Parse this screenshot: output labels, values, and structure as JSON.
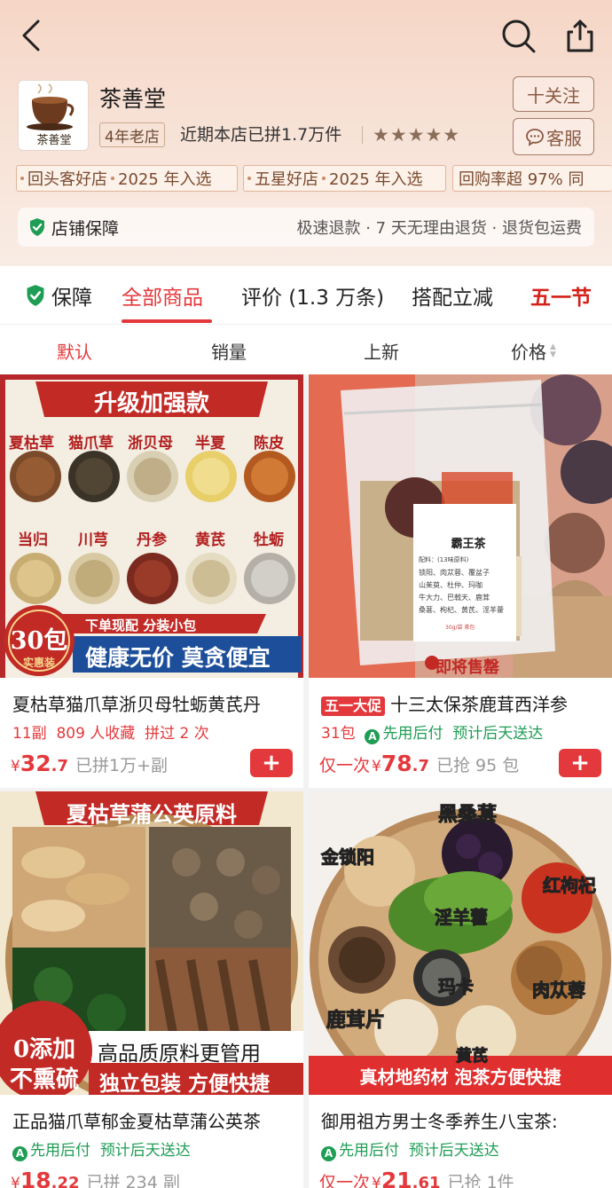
{
  "header": {
    "back_icon": "chevron-left-icon",
    "search_icon": "search-icon",
    "share_icon": "share-icon"
  },
  "store": {
    "name": "茶善堂",
    "logo_text": "茶善堂",
    "years_badge": "4年老店",
    "recent_sales": "近期本店已拼1.7万件",
    "rating_stars": 5,
    "stars_text": "★★★★★",
    "follow_label": "十关注",
    "service_label": "客服"
  },
  "awards": [
    {
      "label": "回头客好店",
      "value": "2025 年入选"
    },
    {
      "label": "五星好店",
      "value": "2025 年入选"
    },
    {
      "label": "回购率超 97% 同",
      "value": ""
    }
  ],
  "guarantee": {
    "title": "店铺保障",
    "desc": "极速退款 · 7 天无理由退货 · 退货包运费"
  },
  "tabs": {
    "protect": "保障",
    "all": "全部商品",
    "reviews": "评价 (1.3 万条)",
    "combo": "搭配立减",
    "festival": "五一节"
  },
  "sort": {
    "default": "默认",
    "sales": "销量",
    "new": "上新",
    "price": "价格"
  },
  "products": [
    {
      "title": "夏枯草猫爪草浙贝母牡蛎黄芪丹",
      "meta_a": "11副",
      "meta_b": "809 人收藏",
      "meta_c": "拼过 2 次",
      "price_symbol": "¥",
      "price_int": "32",
      "price_dec": ".7",
      "sold": "已拼1万+副",
      "add_label": "+",
      "img": {
        "banner": "升级加强款",
        "herbs_row1": [
          "夏枯草",
          "猫爪草",
          "浙贝母",
          "半夏",
          "陈皮"
        ],
        "herbs_row2": [
          "当归",
          "川芎",
          "丹参",
          "黄芪",
          "牡蛎"
        ],
        "pack_count": "30包",
        "pack_sub": "实惠装",
        "ribbon_small": "下单现配 分装小包",
        "ribbon_big": "健康无价 莫贪便宜"
      }
    },
    {
      "promo": "五一大促",
      "title": "十三太保茶鹿茸西洋参",
      "meta_a": "31包",
      "credit": "先用后付",
      "delivery": "预计后天送达",
      "price_prefix": "仅一次",
      "price_symbol": "¥",
      "price_int": "78",
      "price_dec": ".7",
      "sold": "已抢 95 包",
      "add_label": "+",
      "img": {
        "bag_title": "霸王茶",
        "bag_subtitle": "配料：(13味原料)",
        "ingredients_1": "锁阳、肉苁蓉、覆盆子",
        "ingredients_2": "山茱萸、杜仲、玛咖",
        "ingredients_3": "牛大力、巴戟天、鹿茸",
        "ingredients_4": "桑葚、枸杞、黄芪、淫羊藿",
        "net": "30g/袋 茶包",
        "soon": "即将售罄"
      }
    },
    {
      "title": "正品猫爪草郁金夏枯草蒲公英茶",
      "credit": "先用后付",
      "delivery": "预计后天送达",
      "price_symbol": "¥",
      "price_int": "18",
      "price_dec": ".22",
      "sold": "已拼 234 副",
      "img": {
        "banner": "夏枯草蒲公英原料",
        "zero": "0添加",
        "nosulfur": "不熏硫",
        "quality": "高品质原料更管用",
        "pack": "独立包装 方便快捷"
      }
    },
    {
      "title": "御用祖方男士冬季养生八宝茶:",
      "credit": "先用后付",
      "delivery": "预计后天送达",
      "price_prefix": "仅一次",
      "price_symbol": "¥",
      "price_int": "21",
      "price_dec": ".61",
      "sold": "已抢 1件",
      "img": {
        "labels": [
          "黑桑葚",
          "金锁阳",
          "红枸杞",
          "淫羊藿",
          "玛卡",
          "肉苁蓉",
          "鹿茸片",
          "黄芪"
        ],
        "footer": "真材地药材 泡茶方便快捷"
      }
    }
  ],
  "colors": {
    "accent": "#e4393c",
    "green": "#1f9d55",
    "header_bg": "#f6d6c6"
  }
}
